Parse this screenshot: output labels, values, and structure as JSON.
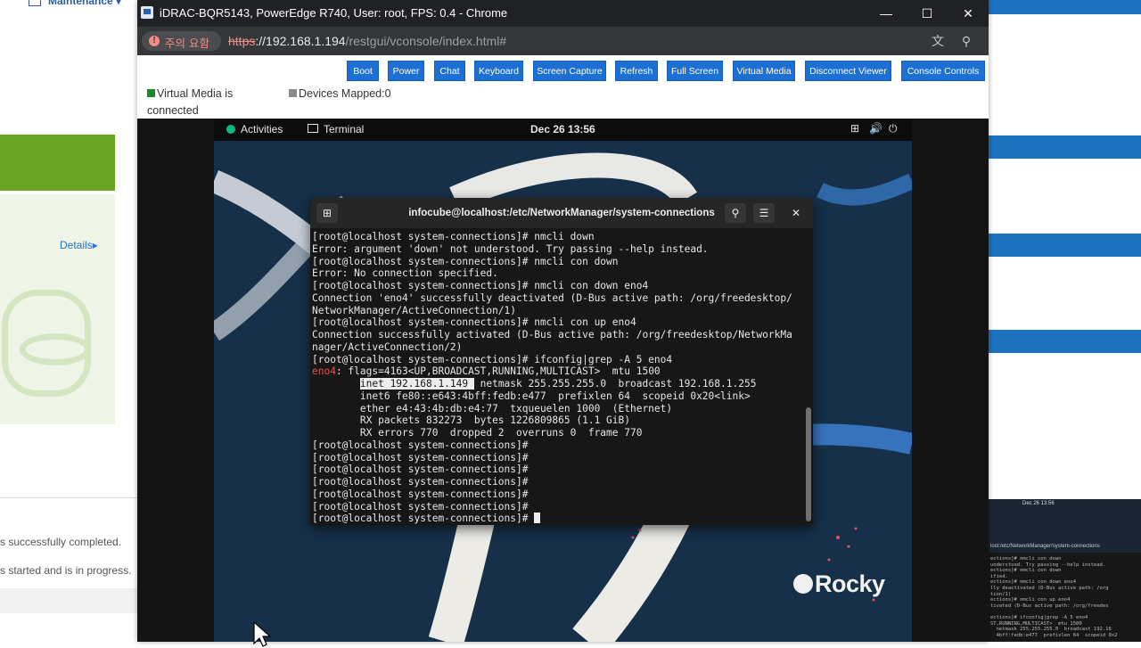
{
  "background": {
    "top_nav": "Maintenance",
    "details_link": "Details",
    "status_lines": [
      "s successfully completed.",
      "s started and is in progress."
    ],
    "thumbnail": {
      "date": "Dec 26 13:56",
      "title": "lost:/etc/NetworkManager/system-connections",
      "lines": [
        "ections]# nmcli con down",
        "understood. Try passing --help instead.",
        "ections]# nmcli con down",
        "ified.",
        "ections]# nmcli con down eno4",
        "lly deactivated (D-Bus active path: /org",
        "tion/1)",
        "ections]# nmcli con up eno4",
        "tivated (D-Bus active path: /org/freedes",
        "",
        "ections]# ifconfig|grep -A 5 eno4",
        "ST,RUNNING,MULTICAST>  mtu 1500",
        "  netmask 255.255.255.0  broadcast 192.16",
        "  4bff:fedb:e477  prefixlen 64  scopeid 0x2"
      ]
    }
  },
  "window": {
    "title": "iDRAC-BQR5143, PowerEdge R740, User: root, FPS: 0.4 - Chrome",
    "controls": {
      "minimize": "—",
      "maximize": "☐",
      "close": "✕"
    }
  },
  "address_bar": {
    "warning_label": "주의 요함",
    "warning_icon": "!",
    "url_scheme": "https",
    "url_sep": "://",
    "url_host": "192.168.1.194",
    "url_path": "/restgui/vconsole/index.html#",
    "translate_icon": "文",
    "zoom_icon": "⚲"
  },
  "toolbar": {
    "buttons": [
      "Boot",
      "Power",
      "Chat",
      "Keyboard",
      "Screen Capture",
      "Refresh",
      "Full Screen",
      "Virtual Media",
      "Disconnect Viewer",
      "Console Controls"
    ]
  },
  "status": {
    "virtual_media": "Virtual Media is connected",
    "devices_mapped": "Devices Mapped:0",
    "vm_color": "#1a8a2a",
    "dev_color": "#8a8a8a"
  },
  "gnome": {
    "activities": "Activities",
    "app": "Terminal",
    "clock": "Dec 26  13:56",
    "network_icon": "⊞",
    "volume_icon": "🔊",
    "power_icon": "⏻"
  },
  "terminal": {
    "title": "infocube@localhost:/etc/NetworkManager/system-connections",
    "new_tab_icon": "⊞",
    "search_icon": "⚲",
    "menu_icon": "☰",
    "close_icon": "✕",
    "prompt": "[root@localhost system-connections]# ",
    "lines": [
      "[root@localhost system-connections]# nmcli down",
      "Error: argument 'down' not understood. Try passing --help instead.",
      "[root@localhost system-connections]# nmcli con down",
      "Error: No connection specified.",
      "[root@localhost system-connections]# nmcli con down eno4",
      "Connection 'eno4' successfully deactivated (D-Bus active path: /org/freedesktop/",
      "NetworkManager/ActiveConnection/1)",
      "[root@localhost system-connections]# nmcli con up eno4",
      "Connection successfully activated (D-Bus active path: /org/freedesktop/NetworkMa",
      "nager/ActiveConnection/2)",
      "[root@localhost system-connections]# ifconfig|grep -A 5 eno4"
    ],
    "eno4_iface": "eno4",
    "eno4_rest": ": flags=4163<UP,BROADCAST,RUNNING,MULTICAST>  mtu 1500",
    "inet_indent": "        ",
    "inet_highlight": "inet 192.168.1.149 ",
    "inet_rest": " netmask 255.255.255.0  broadcast 192.168.1.255",
    "detail_lines": [
      "        inet6 fe80::e643:4bff:fedb:e477  prefixlen 64  scopeid 0x20<link>",
      "        ether e4:43:4b:db:e4:77  txqueuelen 1000  (Ethernet)",
      "        RX packets 832273  bytes 1226809865 (1.1 GiB)",
      "        RX errors 770  dropped 2  overruns 0  frame 770"
    ],
    "prompt_lines": [
      "[root@localhost system-connections]#",
      "[root@localhost system-connections]#",
      "[root@localhost system-connections]#",
      "[root@localhost system-connections]#",
      "[root@localhost system-connections]#",
      "[root@localhost system-connections]#"
    ],
    "last_prompt": "[root@localhost system-connections]# "
  },
  "desktop": {
    "logo": "Rocky"
  },
  "colors": {
    "toolbar_button": "#1c6fd3",
    "chrome_dark": "#202124",
    "terminal_bg": "#171717",
    "desktop_bg": "#163049",
    "error_red": "#e5534b"
  }
}
